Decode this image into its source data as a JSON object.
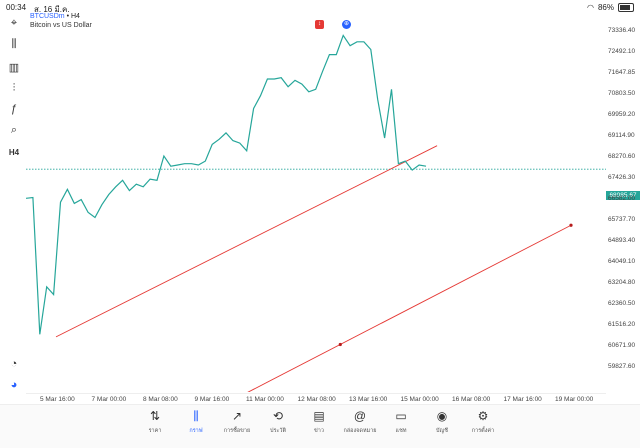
{
  "status": {
    "time": "00:34",
    "date": "ส. 16 มี.ค.",
    "battery": "86%"
  },
  "symbol": {
    "name": "BTCUSDm",
    "timeframe": "H4",
    "description": "Bitcoin vs US Dollar"
  },
  "toolbar": {
    "items": [
      {
        "name": "crosshair-icon",
        "glyph": "⌖"
      },
      {
        "name": "candles-icon",
        "glyph": "⫼"
      },
      {
        "name": "bar-chart-icon",
        "glyph": "▥"
      },
      {
        "name": "indicators-icon",
        "glyph": "⫶"
      },
      {
        "name": "function-icon",
        "glyph": "ƒ"
      },
      {
        "name": "objects-icon",
        "glyph": "⌕"
      },
      {
        "name": "timeframe-icon",
        "glyph": "H4"
      }
    ]
  },
  "price_axis": {
    "labels": [
      "73336.40",
      "72492.10",
      "71647.85",
      "70803.50",
      "69959.20",
      "69114.90",
      "68270.60",
      "67426.30",
      "66582.00",
      "65737.70",
      "64893.40",
      "64049.10",
      "63204.80",
      "62360.50",
      "61516.20",
      "60671.90",
      "59827.60"
    ],
    "current": "68085.67"
  },
  "time_axis": {
    "labels": [
      "5 Mar 16:00",
      "7 Mar 00:00",
      "8 Mar 08:00",
      "9 Mar 16:00",
      "11 Mar 00:00",
      "12 Mar 08:00",
      "13 Mar 16:00",
      "15 Mar 00:00",
      "16 Mar 08:00",
      "17 Mar 16:00",
      "19 Mar 00:00"
    ]
  },
  "chart_data": {
    "type": "line",
    "series": [
      {
        "values": [
          66950,
          66980,
          61650,
          63500,
          63200,
          66800,
          67300,
          66750,
          66900,
          66400,
          66200,
          66700,
          67100,
          67400,
          67650,
          67250,
          67500,
          67400,
          67700,
          67650,
          68600,
          68200,
          68250,
          68300,
          68300,
          68250,
          68400,
          69050,
          69250,
          69500,
          69200,
          69100,
          68800,
          70450,
          70950,
          71600,
          71600,
          71650,
          71300,
          71550,
          71400,
          71100,
          71200,
          71900,
          72550,
          72550,
          73300,
          72900,
          73050,
          73050,
          72750,
          70800,
          69300,
          71200,
          68300,
          68400,
          68050,
          68250,
          68200
        ]
      }
    ],
    "current_price": 68085.67,
    "trendlines": [
      {
        "from": [
          "5 Mar 16:00",
          61550
        ],
        "to": [
          "15 Mar 22:00",
          69000
        ],
        "color": "#e53935"
      },
      {
        "from": [
          "8 Mar 08:00",
          57600
        ],
        "to": [
          "19 Mar 00:00",
          65900
        ],
        "color": "#e53935"
      }
    ],
    "ylim": [
      59400,
      73900
    ],
    "colors": {
      "line": "#26a69a",
      "trend": "#e53935"
    }
  },
  "nav": {
    "items": [
      {
        "name": "nav-quotes",
        "icon": "⇅",
        "label": "ราคา"
      },
      {
        "name": "nav-chart",
        "icon": "⫼",
        "label": "กราฟ",
        "active": true
      },
      {
        "name": "nav-trade",
        "icon": "↗",
        "label": "การซื้อขาย"
      },
      {
        "name": "nav-history",
        "icon": "⟲",
        "label": "ประวัติ"
      },
      {
        "name": "nav-news",
        "icon": "▤",
        "label": "ข่าว"
      },
      {
        "name": "nav-mailbox",
        "icon": "@",
        "label": "กล่องจดหมาย"
      },
      {
        "name": "nav-chat",
        "icon": "▭",
        "label": "แชท"
      },
      {
        "name": "nav-account",
        "icon": "◉",
        "label": "บัญชี"
      },
      {
        "name": "nav-settings",
        "icon": "⚙",
        "label": "การตั้งค่า"
      }
    ]
  }
}
